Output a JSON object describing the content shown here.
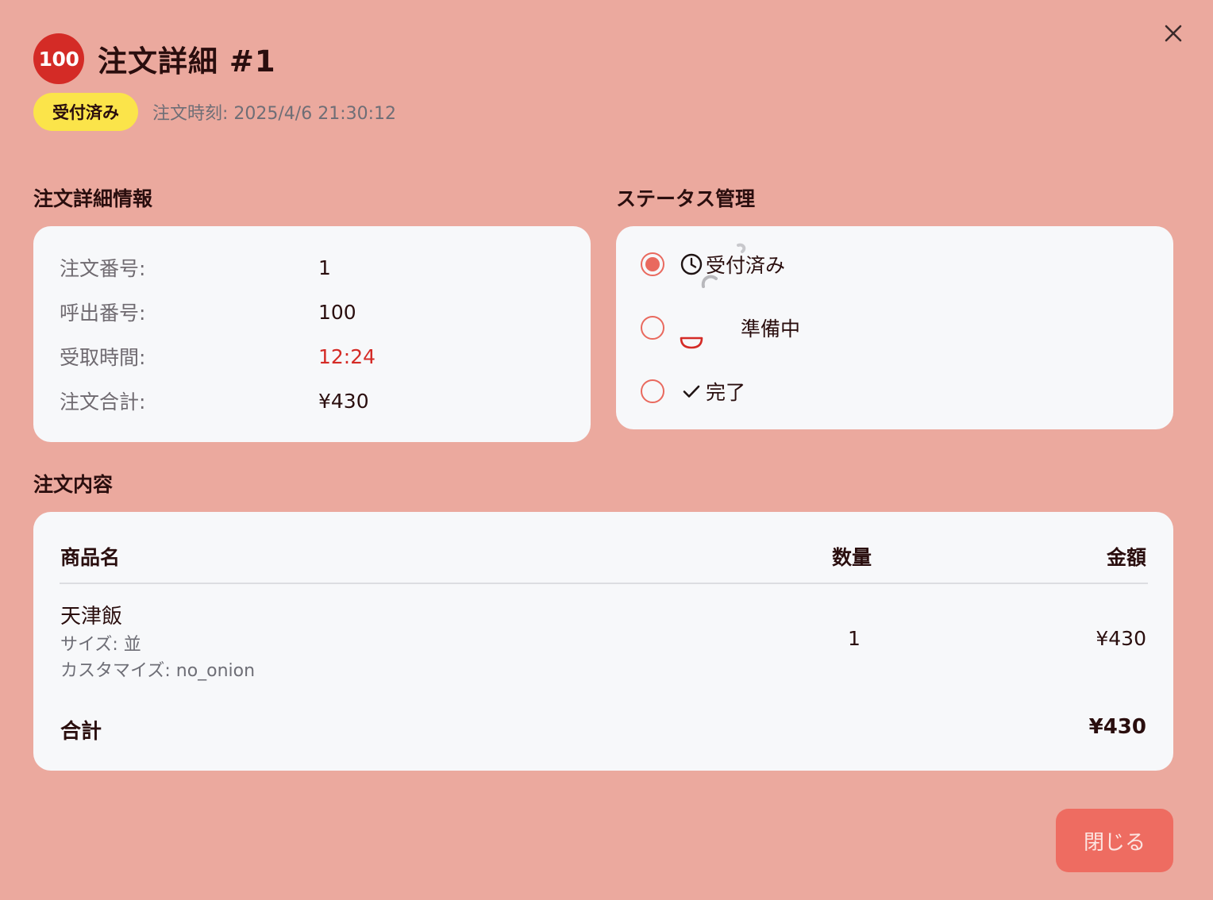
{
  "header": {
    "call_number": "100",
    "title": "注文詳細 #1",
    "status_badge": "受付済み",
    "order_time": "注文時刻: 2025/4/6 21:30:12"
  },
  "details": {
    "section_title": "注文詳細情報",
    "rows": [
      {
        "label": "注文番号:",
        "value": "1"
      },
      {
        "label": "呼出番号:",
        "value": "100"
      },
      {
        "label": "受取時間:",
        "value": "12:24",
        "highlight": "#D42B26"
      },
      {
        "label": "注文合計:",
        "value": "¥430"
      }
    ]
  },
  "status_management": {
    "section_title": "ステータス管理",
    "options": [
      {
        "label": "受付済み",
        "icon": "clock-icon",
        "selected": true
      },
      {
        "label": "準備中",
        "icon": "bowl-icon",
        "selected": false
      },
      {
        "label": "完了",
        "icon": "check-icon",
        "selected": false
      }
    ]
  },
  "order_items": {
    "section_title": "注文内容",
    "columns": [
      "商品名",
      "数量",
      "金額"
    ],
    "items": [
      {
        "name": "天津飯",
        "size": "サイズ: 並",
        "customize": "カスタマイズ: no_onion",
        "quantity": "1",
        "price": "¥430"
      }
    ],
    "total_label": "合計",
    "total_value": "¥430"
  },
  "footer": {
    "close_label": "閉じる"
  },
  "colors": {
    "overlay_background": "#EBA99E",
    "card_background": "#F7F8FA",
    "accent": "#E9695E",
    "badge_red": "#D42B26",
    "status_yellow": "#FBE44A"
  }
}
